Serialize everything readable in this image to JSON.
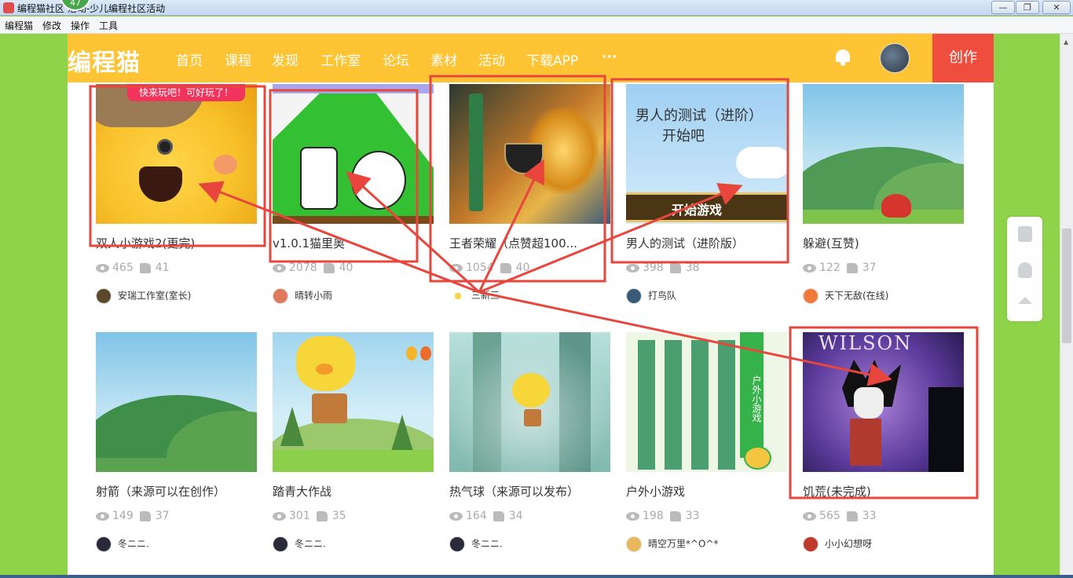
{
  "window": {
    "title": "编程猫社区  活动-少儿编程社区活动",
    "badge": "47",
    "min": "—",
    "max": "❐",
    "close": "✕"
  },
  "menubar": [
    "编程猫",
    "修改",
    "操作",
    "工具"
  ],
  "nav": {
    "logo": "编程猫",
    "items": [
      "首页",
      "课程",
      "发现",
      "工作室",
      "论坛",
      "素材",
      "活动",
      "下载APP",
      "···"
    ],
    "create": "创作"
  },
  "cards": [
    {
      "title": "双人小游戏2(更完)",
      "views": "465",
      "likes": "41",
      "author": "安瑞工作室(室长)",
      "banner": "快来玩吧！可好玩了！",
      "avatar_color": "#5b4a2a"
    },
    {
      "title": "v1.0.1猫里奥",
      "views": "2078",
      "likes": "40",
      "author": "晴转小雨",
      "avatar_color": "#e07a5a"
    },
    {
      "title": "王者荣耀（点赞超100...",
      "views": "1054",
      "likes": "40",
      "author": "",
      "avatar_color": "#f5d64a"
    },
    {
      "title": "男人的测试（进阶版）",
      "views": "398",
      "likes": "38",
      "author": "打鸟队",
      "thumb_text_1": "男人的测试（进阶）",
      "thumb_text_2": "开始吧",
      "thumb_btn": "开始游戏",
      "avatar_color": "#3a5a7a"
    },
    {
      "title": "躲避(互赞)",
      "views": "122",
      "likes": "37",
      "author": "天下无敌(在线)",
      "avatar_color": "#f07a3a"
    },
    {
      "title": "射箭（来源可以在创作）",
      "views": "149",
      "likes": "37",
      "author": "冬ニニ.",
      "avatar_color": "#2a2a3a"
    },
    {
      "title": "踏青大作战",
      "views": "301",
      "likes": "35",
      "author": "冬ニニ.",
      "avatar_color": "#2a2a3a"
    },
    {
      "title": "热气球（来源可以发布）",
      "views": "164",
      "likes": "34",
      "author": "冬ニニ.",
      "avatar_color": "#2a2a3a"
    },
    {
      "title": "户外小游戏",
      "views": "198",
      "likes": "33",
      "author": "晴空万里*^O^*",
      "thumb_text_1": "户外小游戏",
      "avatar_color": "#e8b85a"
    },
    {
      "title": "饥荒(未完成)",
      "views": "565",
      "likes": "33",
      "author": "小小幻想呀",
      "thumb_text_1": "WILSON",
      "avatar_color": "#c0392b"
    }
  ],
  "mid_author": "三新三",
  "annotation_color": "#e8453c"
}
